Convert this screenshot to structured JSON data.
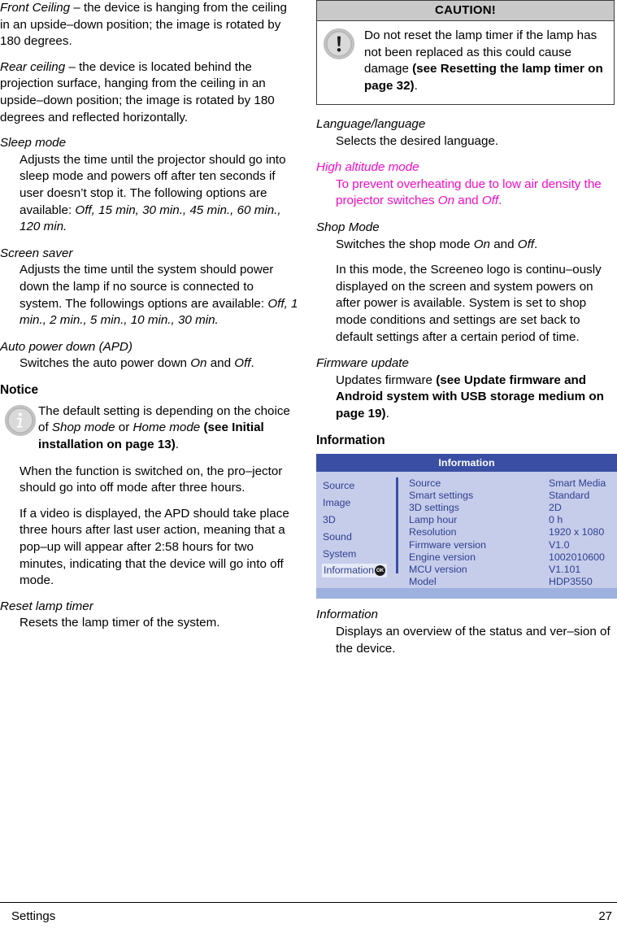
{
  "document": {
    "footer": {
      "section": "Settings",
      "page_number": "27"
    }
  },
  "left_column": {
    "blocks": [
      {
        "id": "front_ceiling",
        "text_html": "<i>Front Ceiling</i> – the device is hanging from the ceiling in an upside–down position; the image is rotated by 180 degrees."
      },
      {
        "id": "rear_ceiling",
        "text_html": "<i>Rear ceiling</i> – the device is located behind the projection surface, hanging from the ceiling in an upside–down position; the image is rotated by 180 degrees and reflected horizontally."
      }
    ],
    "sleep_mode": {
      "term": "Sleep mode",
      "definition_html": "Adjusts the time until the projector should go into sleep mode and powers off after ten seconds if user doesn’t stop it. The following options are available: <i>Off, 15 min, 30 min., 45 min., 60 min., 120 min.</i>"
    },
    "screen_saver": {
      "term": "Screen saver",
      "definition_html": "Adjusts the time until the system should power down the lamp if no source is connected to system. The followings options are available: <i>Off, 1 min., 2 min., 5 min., 10 min., 30 min.</i>"
    },
    "auto_power_down": {
      "term": "Auto power down (APD)",
      "definition_html": "Switches the auto power down <i>On</i> and <i>Off</i>."
    },
    "notice": {
      "heading": "Notice",
      "icon": "info-icon",
      "body_html": "The default setting is depending on the choice of <i>Shop mode</i> or <i>Home mode</i> <b>(see Initial installation on page 13)</b>.",
      "paragraphs": [
        "When the function is switched on, the pro–jector should go into off mode after three hours.",
        "If a video is displayed, the APD should take place three hours after last user action, meaning that a pop–up will appear after 2:58 hours for two minutes, indicating that the device will go into off mode."
      ]
    },
    "reset_lamp_timer": {
      "term": "Reset lamp timer",
      "definition_html": "Resets the lamp timer of the system."
    }
  },
  "right_column": {
    "caution": {
      "title": "CAUTION!",
      "icon": "exclamation-icon",
      "body_html": "Do not reset the lamp timer if the lamp has not been replaced as this could cause damage <b>(see Resetting the lamp timer on page 32)</b>."
    },
    "language": {
      "term": "Language/language",
      "definition_html": "Selects the desired language."
    },
    "high_altitude": {
      "term": "High altitude mode",
      "definition_html": "To prevent overheating due to low air density the projector switches <i>On</i> and <i>Off</i>.",
      "color": "#F30CC8"
    },
    "shop_mode": {
      "term": "Shop Mode",
      "definition_html": "Switches the shop mode <i>On</i> and <i>Off</i>.",
      "paragraph": "In this mode, the Screeneo logo is continu–ously displayed on the screen and system powers on after power is available. System is set to shop mode conditions and settings are set back to default settings after a certain period of time."
    },
    "firmware_update": {
      "term": "Firmware update",
      "definition_html": "Updates firmware <b>(see Update firmware and Android system with USB storage medium on page 19)</b>."
    },
    "information_heading": "Information",
    "osd": {
      "title": "Information",
      "accent_header": "#3A4FA4",
      "accent_body": "#C6CDEB",
      "accent_text": "#2E3F8F",
      "accent_footer": "#9EB0DE",
      "menu": [
        {
          "label": "Source",
          "selected": false
        },
        {
          "label": "Image",
          "selected": false
        },
        {
          "label": "3D",
          "selected": false
        },
        {
          "label": "Sound",
          "selected": false
        },
        {
          "label": "System",
          "selected": false
        },
        {
          "label": "Information",
          "selected": true,
          "badge": "OK"
        }
      ],
      "rows": [
        {
          "key": "Source",
          "value": "Smart Media"
        },
        {
          "key": "Smart settings",
          "value": "Standard"
        },
        {
          "key": "3D settings",
          "value": "2D"
        },
        {
          "key": "Lamp hour",
          "value": "0 h"
        },
        {
          "key": "Resolution",
          "value": "1920 x 1080"
        },
        {
          "key": "Firmware version",
          "value": "V1.0"
        },
        {
          "key": "Engine version",
          "value": "1002010600"
        },
        {
          "key": "MCU version",
          "value": "V1.101"
        },
        {
          "key": "Model",
          "value": "HDP3550"
        }
      ]
    },
    "information_entry": {
      "term": "Information",
      "definition_html": "Displays an overview of the status and ver–sion of the device."
    }
  }
}
